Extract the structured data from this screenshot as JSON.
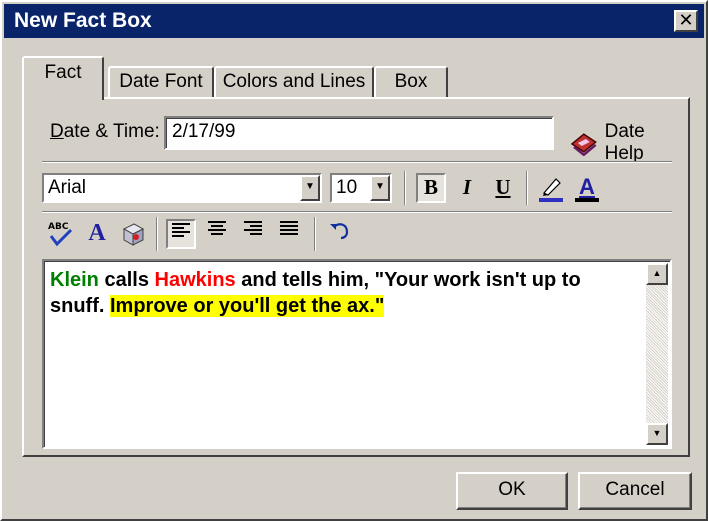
{
  "window": {
    "title": "New Fact Box",
    "close_glyph": "✕"
  },
  "tabs": [
    {
      "label": "Fact",
      "active": true
    },
    {
      "label": "Date Font",
      "active": false
    },
    {
      "label": "Colors and Lines",
      "active": false
    },
    {
      "label": "Box",
      "active": false
    }
  ],
  "fact": {
    "date_label_underlined": "D",
    "date_label_rest": "ate & Time:",
    "date_value": "2/17/99",
    "date_help_label": "Date Help"
  },
  "format_toolbar": {
    "font": "Arial",
    "size": "10",
    "bold": "B",
    "italic": "I",
    "underline": "U",
    "font_color_glyph": "A",
    "bold_pressed": true
  },
  "edit_toolbar": {
    "abc_label": "ABC",
    "font_glyph": "A",
    "align_left_pressed": true
  },
  "text": {
    "name1": "Klein",
    "part1": " calls ",
    "name2": "Hawkins",
    "part2": " and tells him, \"Your work isn't up to snuff.  ",
    "highlight": "Improve or you'll get the ax.\""
  },
  "colors": {
    "title_bar": "#0a246a",
    "name1_color": "#008000",
    "name2_color": "#ff0000",
    "highlight": "#ffff00"
  },
  "buttons": {
    "ok": "OK",
    "cancel": "Cancel"
  }
}
